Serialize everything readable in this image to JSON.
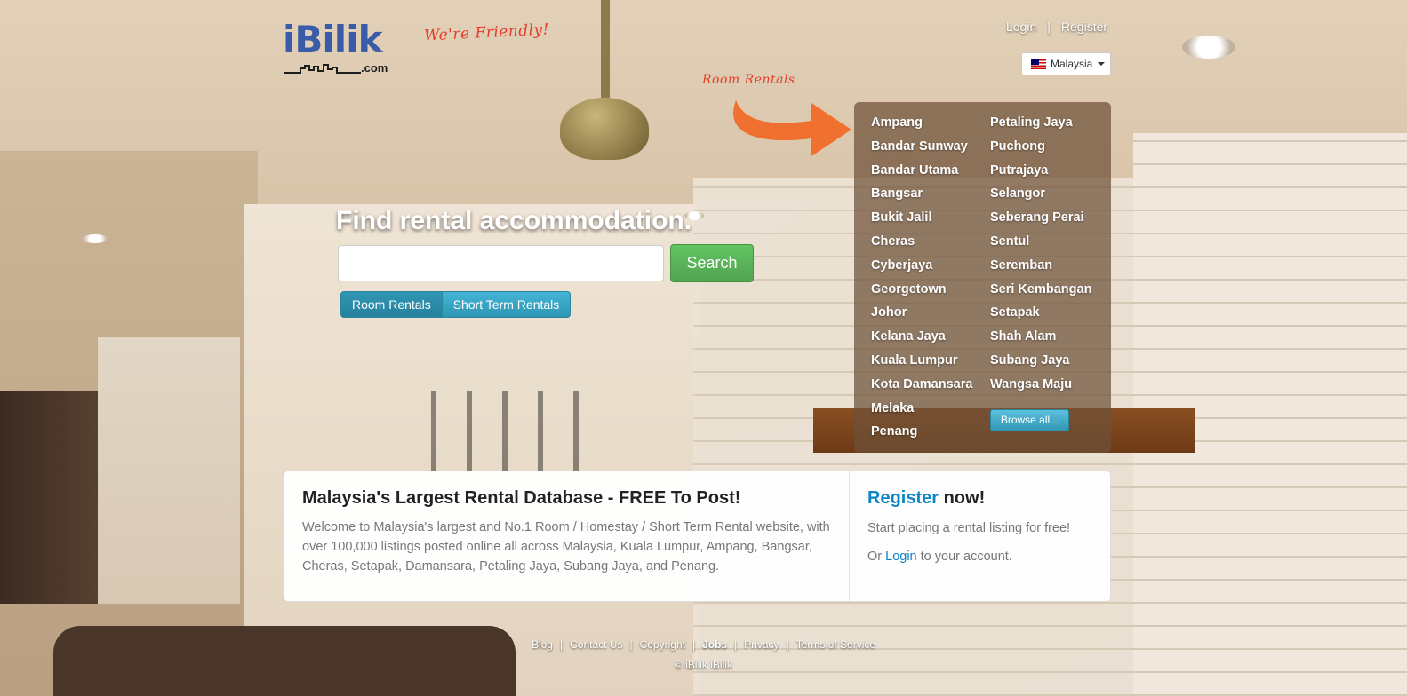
{
  "brand": {
    "logo_text": "iBilik",
    "logo_suffix": ".com",
    "tagline": "We're Friendly!",
    "color": "#3a5ba8"
  },
  "header": {
    "login": "Login",
    "separator": "|",
    "register": "Register",
    "country": "Malaysia"
  },
  "callout": {
    "label": "Room Rentals",
    "arrow_color": "#f07030"
  },
  "search": {
    "heading": "Find rental accommodation.",
    "input_value": "",
    "button_label": "Search",
    "tabs": [
      {
        "label": "Room Rentals",
        "active": true
      },
      {
        "label": "Short Term Rentals",
        "active": false
      }
    ]
  },
  "locations": {
    "column1": [
      "Ampang",
      "Bandar Sunway",
      "Bandar Utama",
      "Bangsar",
      "Bukit Jalil",
      "Cheras",
      "Cyberjaya",
      "Georgetown",
      "Johor",
      "Kelana Jaya",
      "Kuala Lumpur",
      "Kota Damansara",
      "Melaka",
      "Penang"
    ],
    "column2": [
      "Petaling Jaya",
      "Puchong",
      "Putrajaya",
      "Selangor",
      "Seberang Perai",
      "Sentul",
      "Seremban",
      "Seri Kembangan",
      "Setapak",
      "Shah Alam",
      "Subang Jaya",
      "Wangsa Maju"
    ],
    "browse_all": "Browse all..."
  },
  "info": {
    "title": "Malaysia's Largest Rental Database - FREE To Post!",
    "description": "Welcome to Malaysia's largest and No.1 Room / Homestay / Short Term Rental website, with over 100,000 listings posted online all across Malaysia, Kuala Lumpur, Ampang, Bangsar, Cheras, Setapak, Damansara, Petaling Jaya, Subang Jaya, and Penang.",
    "register_link": "Register",
    "register_suffix": " now!",
    "register_line": "Start placing a rental listing for free!",
    "login_prefix": "Or ",
    "login_link": "Login",
    "login_suffix": " to your account."
  },
  "footer": {
    "links": [
      "Blog",
      "Contact Us",
      "Copyright",
      "Jobs",
      "Privacy",
      "Terms of Service"
    ],
    "copyright": "© iBilik iBilik"
  }
}
